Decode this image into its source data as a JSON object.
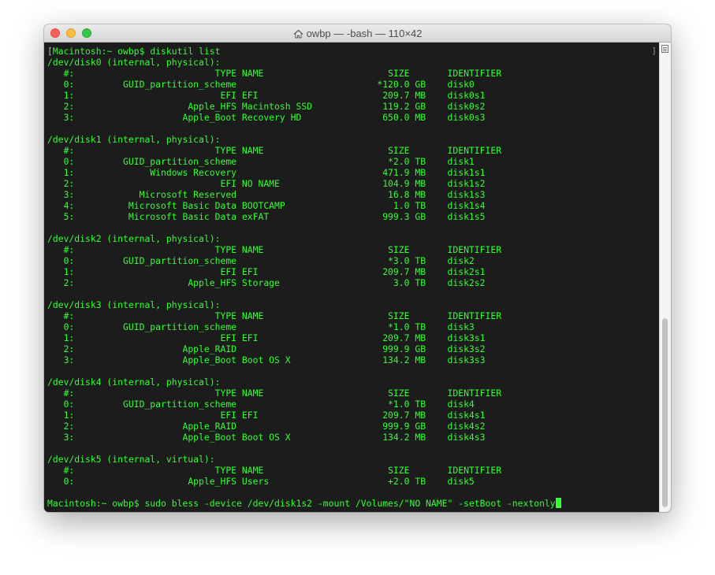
{
  "window": {
    "title": "owbp — -bash — 110×42",
    "icon": "home-icon"
  },
  "terminal": {
    "first_prompt": "Macintosh:~ owbp$ ",
    "first_command": "diskutil list",
    "disks": [
      {
        "header": "/dev/disk0 (internal, physical):",
        "columns": {
          "num": "#:",
          "type": "TYPE",
          "name": "NAME",
          "size": "SIZE",
          "id": "IDENTIFIER"
        },
        "partitions": [
          {
            "num": "0:",
            "type": "GUID_partition_scheme",
            "name": "",
            "size": "*120.0 GB",
            "id": "disk0"
          },
          {
            "num": "1:",
            "type": "EFI",
            "name": "EFI",
            "size": "209.7 MB",
            "id": "disk0s1"
          },
          {
            "num": "2:",
            "type": "Apple_HFS",
            "name": "Macintosh SSD",
            "size": "119.2 GB",
            "id": "disk0s2"
          },
          {
            "num": "3:",
            "type": "Apple_Boot",
            "name": "Recovery HD",
            "size": "650.0 MB",
            "id": "disk0s3"
          }
        ]
      },
      {
        "header": "/dev/disk1 (internal, physical):",
        "columns": {
          "num": "#:",
          "type": "TYPE",
          "name": "NAME",
          "size": "SIZE",
          "id": "IDENTIFIER"
        },
        "partitions": [
          {
            "num": "0:",
            "type": "GUID_partition_scheme",
            "name": "",
            "size": "*2.0 TB",
            "id": "disk1"
          },
          {
            "num": "1:",
            "type": "Windows Recovery",
            "name": "",
            "size": "471.9 MB",
            "id": "disk1s1"
          },
          {
            "num": "2:",
            "type": "EFI",
            "name": "NO NAME",
            "size": "104.9 MB",
            "id": "disk1s2"
          },
          {
            "num": "3:",
            "type": "Microsoft Reserved",
            "name": "",
            "size": "16.8 MB",
            "id": "disk1s3"
          },
          {
            "num": "4:",
            "type": "Microsoft Basic Data",
            "name": "BOOTCAMP",
            "size": "1.0 TB",
            "id": "disk1s4"
          },
          {
            "num": "5:",
            "type": "Microsoft Basic Data",
            "name": "exFAT",
            "size": "999.3 GB",
            "id": "disk1s5"
          }
        ]
      },
      {
        "header": "/dev/disk2 (internal, physical):",
        "columns": {
          "num": "#:",
          "type": "TYPE",
          "name": "NAME",
          "size": "SIZE",
          "id": "IDENTIFIER"
        },
        "partitions": [
          {
            "num": "0:",
            "type": "GUID_partition_scheme",
            "name": "",
            "size": "*3.0 TB",
            "id": "disk2"
          },
          {
            "num": "1:",
            "type": "EFI",
            "name": "EFI",
            "size": "209.7 MB",
            "id": "disk2s1"
          },
          {
            "num": "2:",
            "type": "Apple_HFS",
            "name": "Storage",
            "size": "3.0 TB",
            "id": "disk2s2"
          }
        ]
      },
      {
        "header": "/dev/disk3 (internal, physical):",
        "columns": {
          "num": "#:",
          "type": "TYPE",
          "name": "NAME",
          "size": "SIZE",
          "id": "IDENTIFIER"
        },
        "partitions": [
          {
            "num": "0:",
            "type": "GUID_partition_scheme",
            "name": "",
            "size": "*1.0 TB",
            "id": "disk3"
          },
          {
            "num": "1:",
            "type": "EFI",
            "name": "EFI",
            "size": "209.7 MB",
            "id": "disk3s1"
          },
          {
            "num": "2:",
            "type": "Apple_RAID",
            "name": "",
            "size": "999.9 GB",
            "id": "disk3s2"
          },
          {
            "num": "3:",
            "type": "Apple_Boot",
            "name": "Boot OS X",
            "size": "134.2 MB",
            "id": "disk3s3"
          }
        ]
      },
      {
        "header": "/dev/disk4 (internal, physical):",
        "columns": {
          "num": "#:",
          "type": "TYPE",
          "name": "NAME",
          "size": "SIZE",
          "id": "IDENTIFIER"
        },
        "partitions": [
          {
            "num": "0:",
            "type": "GUID_partition_scheme",
            "name": "",
            "size": "*1.0 TB",
            "id": "disk4"
          },
          {
            "num": "1:",
            "type": "EFI",
            "name": "EFI",
            "size": "209.7 MB",
            "id": "disk4s1"
          },
          {
            "num": "2:",
            "type": "Apple_RAID",
            "name": "",
            "size": "999.9 GB",
            "id": "disk4s2"
          },
          {
            "num": "3:",
            "type": "Apple_Boot",
            "name": "Boot OS X",
            "size": "134.2 MB",
            "id": "disk4s3"
          }
        ]
      },
      {
        "header": "/dev/disk5 (internal, virtual):",
        "columns": {
          "num": "#:",
          "type": "TYPE",
          "name": "NAME",
          "size": "SIZE",
          "id": "IDENTIFIER"
        },
        "partitions": [
          {
            "num": "0:",
            "type": "Apple_HFS",
            "name": "Users",
            "size": "+2.0 TB",
            "id": "disk5"
          }
        ]
      }
    ],
    "last_prompt": "Macintosh:~ owbp$ ",
    "last_command": "sudo bless -device /dev/disk1s2 -mount /Volumes/\"NO NAME\" -setBoot -nextonly"
  },
  "colors": {
    "terminal_bg": "#1c1c1c",
    "terminal_fg": "#33ff33"
  }
}
